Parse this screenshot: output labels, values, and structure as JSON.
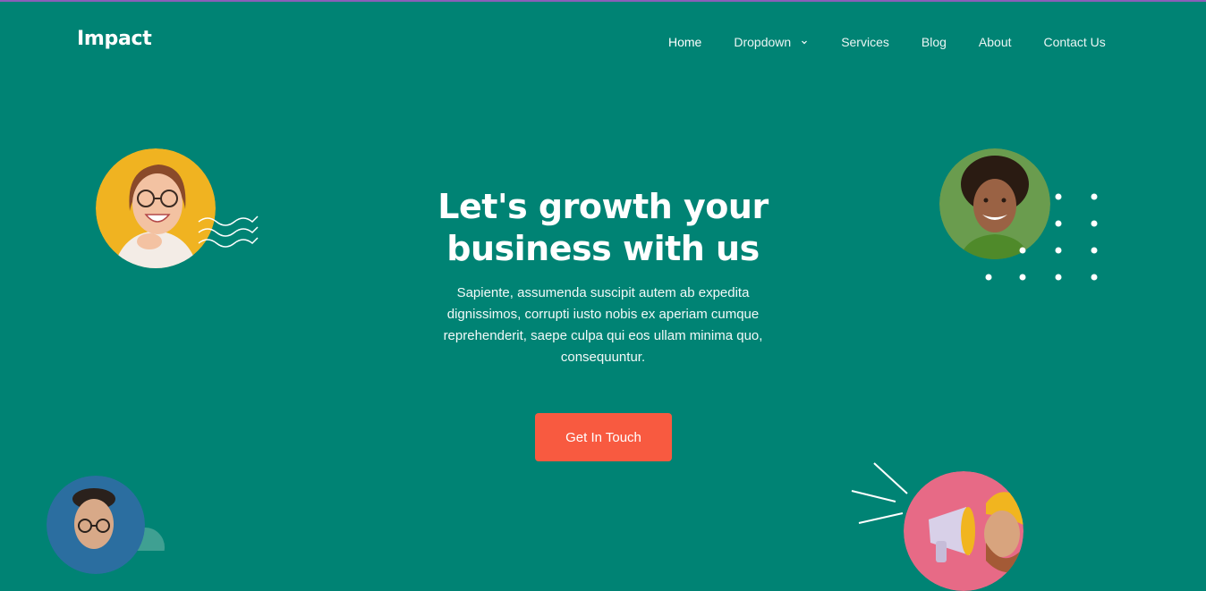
{
  "brand": {
    "name": "Impact"
  },
  "nav": {
    "items": [
      {
        "label": "Home",
        "active": true
      },
      {
        "label": "Dropdown",
        "icon": "chevron-down-icon"
      },
      {
        "label": "Services"
      },
      {
        "label": "Blog"
      },
      {
        "label": "About"
      },
      {
        "label": "Contact Us"
      }
    ]
  },
  "hero": {
    "title_line1": "Let's growth your",
    "title_line2": "business with us",
    "description": "Sapiente, assumenda suscipit autem ab expedita dignissimos, corrupti iusto nobis ex aperiam cumque reprehenderit, saepe culpa qui eos ullam minima quo, consequuntur.",
    "cta_label": "Get In Touch"
  },
  "colors": {
    "background": "#008374",
    "accent": "#f85a40",
    "top_line": "#8a5fb8"
  }
}
